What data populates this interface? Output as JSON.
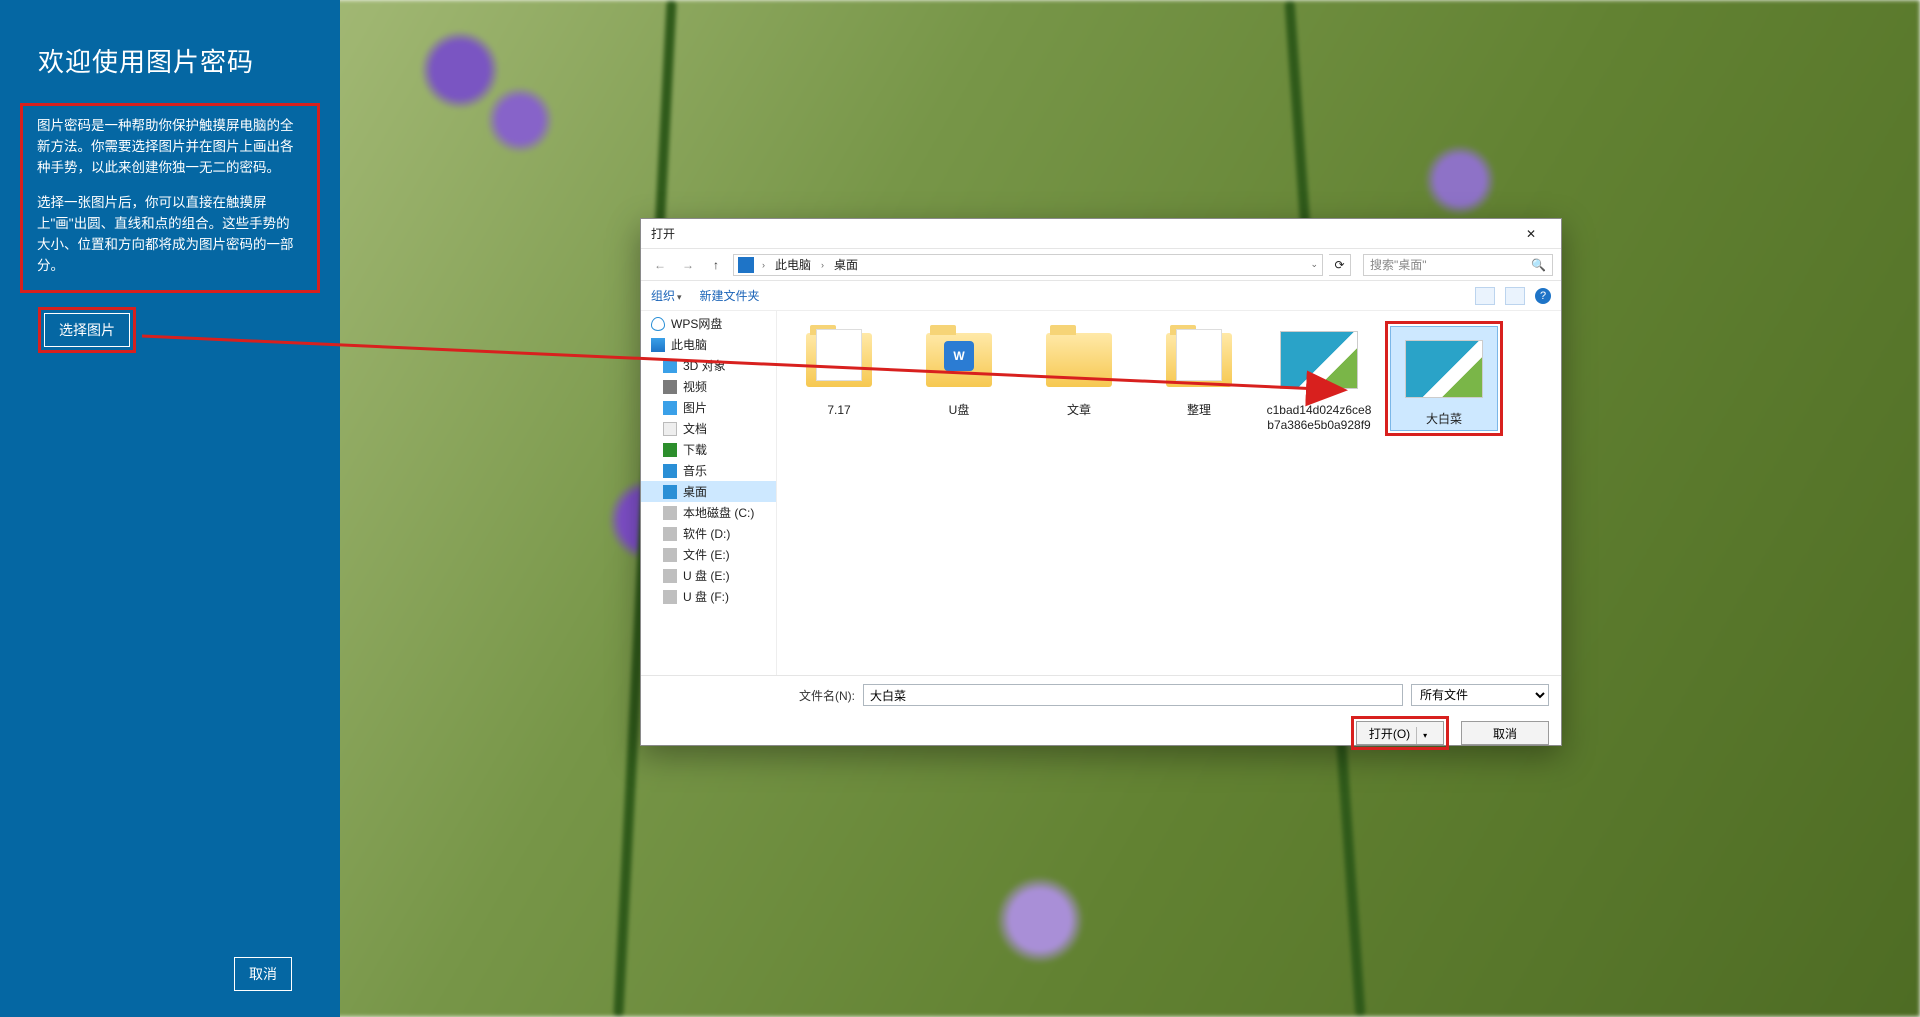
{
  "side": {
    "title": "欢迎使用图片密码",
    "para1": "图片密码是一种帮助你保护触摸屏电脑的全新方法。你需要选择图片并在图片上画出各种手势，以此来创建你独一无二的密码。",
    "para2": "选择一张图片后，你可以直接在触摸屏上\"画\"出圆、直线和点的组合。这些手势的大小、位置和方向都将成为图片密码的一部分。",
    "choose_btn": "选择图片",
    "cancel_btn": "取消"
  },
  "dlg": {
    "title": "打开",
    "close_glyph": "✕",
    "nav": {
      "back": "←",
      "fwd": "→",
      "up": "↑",
      "refresh": "⟳"
    },
    "breadcrumb": {
      "root_icon": "▣",
      "seg1": "此电脑",
      "seg2": "桌面"
    },
    "search_placeholder": "搜索\"桌面\"",
    "toolbar": {
      "organize": "组织",
      "newfolder": "新建文件夹"
    },
    "tree": {
      "wps": "WPS网盘",
      "pc": "此电脑",
      "threeD": "3D 对象",
      "video": "视频",
      "pictures": "图片",
      "docs": "文档",
      "downloads": "下载",
      "music": "音乐",
      "desktop": "桌面",
      "c": "本地磁盘 (C:)",
      "d": "软件 (D:)",
      "e": "文件 (E:)",
      "u1": "U 盘 (E:)",
      "u2": "U 盘 (F:)"
    },
    "files": {
      "f1": "7.17",
      "f2": "U盘",
      "f3": "文章",
      "f4": "整理",
      "img1": "c1bad14d024z6ce8b7a386e5b0a928f9",
      "img2": "大白菜"
    },
    "filename_label": "文件名(N):",
    "filename_value": "大白菜",
    "filter": "所有文件",
    "open_btn": "打开(O)",
    "cancel_btn": "取消"
  }
}
